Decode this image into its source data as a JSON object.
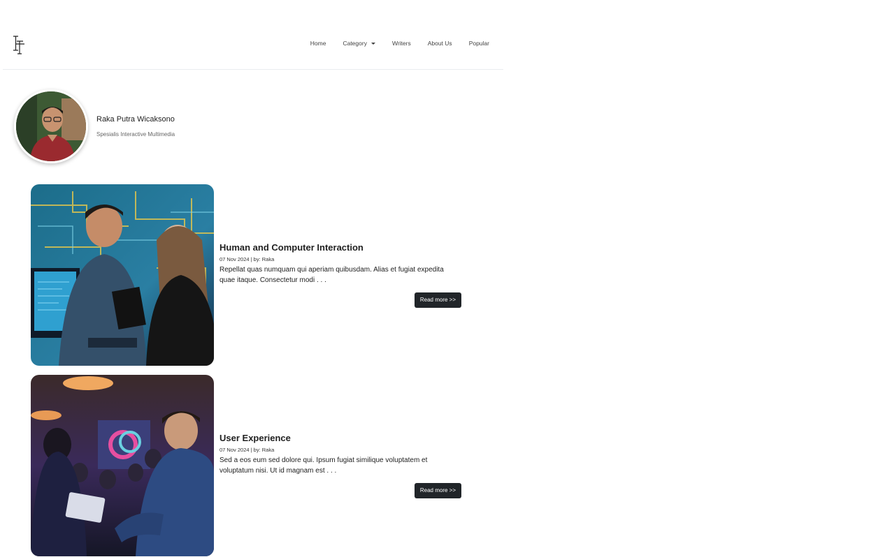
{
  "logo": {
    "icon": "serif-logo-mark"
  },
  "nav": {
    "items": [
      {
        "label": "Home"
      },
      {
        "label": "Category"
      },
      {
        "label": "Writers"
      },
      {
        "label": "About Us"
      },
      {
        "label": "Popular"
      }
    ]
  },
  "profile": {
    "name": "Raka Putra Wicaksono",
    "role": "Spesialis Interactive Multimedia"
  },
  "articles": [
    {
      "title": "Human and Computer Interaction",
      "meta": "07 Nov 2024 | by: Raka",
      "excerpt": "Repellat quas numquam qui aperiam quibusdam. Alias et fugiat expedita quae itaque. Consectetur modi . . .",
      "button": "Read more >>"
    },
    {
      "title": "User Experience",
      "meta": "07 Nov 2024 | by: Raka",
      "excerpt": "Sed a eos eum sed dolore qui. Ipsum fugiat similique voluptatem et voluptatum nisi. Ut id magnam est . . .",
      "button": "Read more >>"
    }
  ],
  "colors": {
    "button_bg": "#212529",
    "text": "#212529"
  }
}
